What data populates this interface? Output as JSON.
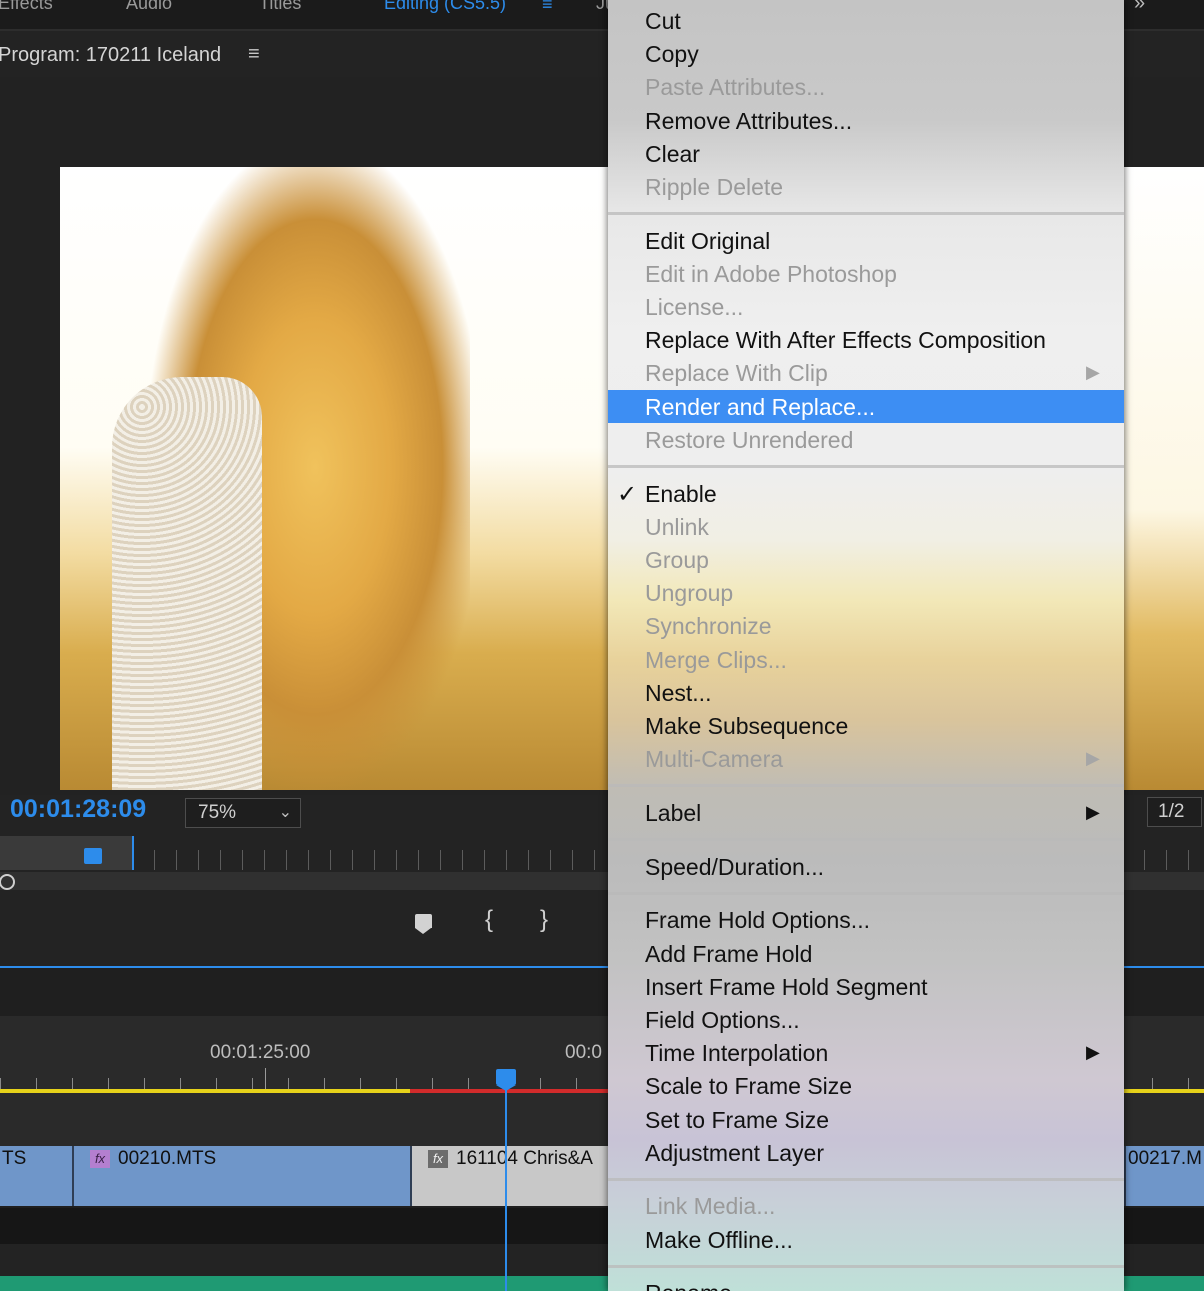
{
  "workspace_tabs": [
    {
      "label": "Effects",
      "active": false
    },
    {
      "label": "Audio",
      "active": false
    },
    {
      "label": "Titles",
      "active": false
    },
    {
      "label": "Editing (CS5.5)",
      "active": true
    },
    {
      "label": "Ju",
      "active": false
    }
  ],
  "workspace_menu_icon": "hamburger-icon",
  "workspace_overflow_glyph": "»",
  "program_monitor": {
    "title": "Program: 170211 Iceland",
    "menu_glyph": "≡",
    "timecode": "00:01:28:09",
    "zoom": "75%",
    "resolution": "1/2"
  },
  "transport": {
    "marker_icon": "add-marker-icon",
    "mark_in_glyph": "{",
    "mark_out_glyph": "}"
  },
  "timeline": {
    "ruler_times": [
      "00:01:25:00",
      "00:0"
    ],
    "clips": [
      {
        "name": "TS",
        "fx": false
      },
      {
        "name": "00210.MTS",
        "fx": true
      },
      {
        "name": "161104 Chris&A",
        "fx": true
      },
      {
        "name": "00217.M",
        "fx": false
      }
    ],
    "fx_label": "fx"
  },
  "context_menu": {
    "groups": [
      [
        {
          "label": "Cut",
          "enabled": true
        },
        {
          "label": "Copy",
          "enabled": true
        },
        {
          "label": "Paste Attributes...",
          "enabled": false
        },
        {
          "label": "Remove Attributes...",
          "enabled": true
        },
        {
          "label": "Clear",
          "enabled": true
        },
        {
          "label": "Ripple Delete",
          "enabled": false
        }
      ],
      [
        {
          "label": "Edit Original",
          "enabled": true
        },
        {
          "label": "Edit in Adobe Photoshop",
          "enabled": false
        },
        {
          "label": "License...",
          "enabled": false
        },
        {
          "label": "Replace With After Effects Composition",
          "enabled": true
        },
        {
          "label": "Replace With Clip",
          "enabled": false,
          "submenu": true
        },
        {
          "label": "Render and Replace...",
          "enabled": true,
          "highlighted": true
        },
        {
          "label": "Restore Unrendered",
          "enabled": false
        }
      ],
      [
        {
          "label": "Enable",
          "enabled": true,
          "checked": true
        },
        {
          "label": "Unlink",
          "enabled": false
        },
        {
          "label": "Group",
          "enabled": false
        },
        {
          "label": "Ungroup",
          "enabled": false
        },
        {
          "label": "Synchronize",
          "enabled": false
        },
        {
          "label": "Merge Clips...",
          "enabled": false
        },
        {
          "label": "Nest...",
          "enabled": true
        },
        {
          "label": "Make Subsequence",
          "enabled": true
        },
        {
          "label": "Multi-Camera",
          "enabled": false,
          "submenu": true
        }
      ],
      [
        {
          "label": "Label",
          "enabled": true,
          "submenu": true
        }
      ],
      [
        {
          "label": "Speed/Duration...",
          "enabled": true
        }
      ],
      [
        {
          "label": "Frame Hold Options...",
          "enabled": true
        },
        {
          "label": "Add Frame Hold",
          "enabled": true
        },
        {
          "label": "Insert Frame Hold Segment",
          "enabled": true
        },
        {
          "label": "Field Options...",
          "enabled": true
        },
        {
          "label": "Time Interpolation",
          "enabled": true,
          "submenu": true
        },
        {
          "label": "Scale to Frame Size",
          "enabled": true
        },
        {
          "label": "Set to Frame Size",
          "enabled": true
        },
        {
          "label": "Adjustment Layer",
          "enabled": true
        }
      ],
      [
        {
          "label": "Link Media...",
          "enabled": false
        },
        {
          "label": "Make Offline...",
          "enabled": true
        }
      ],
      [
        {
          "label": "Rename...",
          "enabled": true
        }
      ]
    ],
    "check_glyph": "✓",
    "submenu_glyph": "▶"
  },
  "colors": {
    "accent": "#2d8ceb",
    "menu_highlight": "#3d8ef3",
    "clip_blue": "#6f96c9",
    "render_yellow": "#e6d21a",
    "render_red": "#d22b2b",
    "audio_green": "#1f9a73"
  }
}
